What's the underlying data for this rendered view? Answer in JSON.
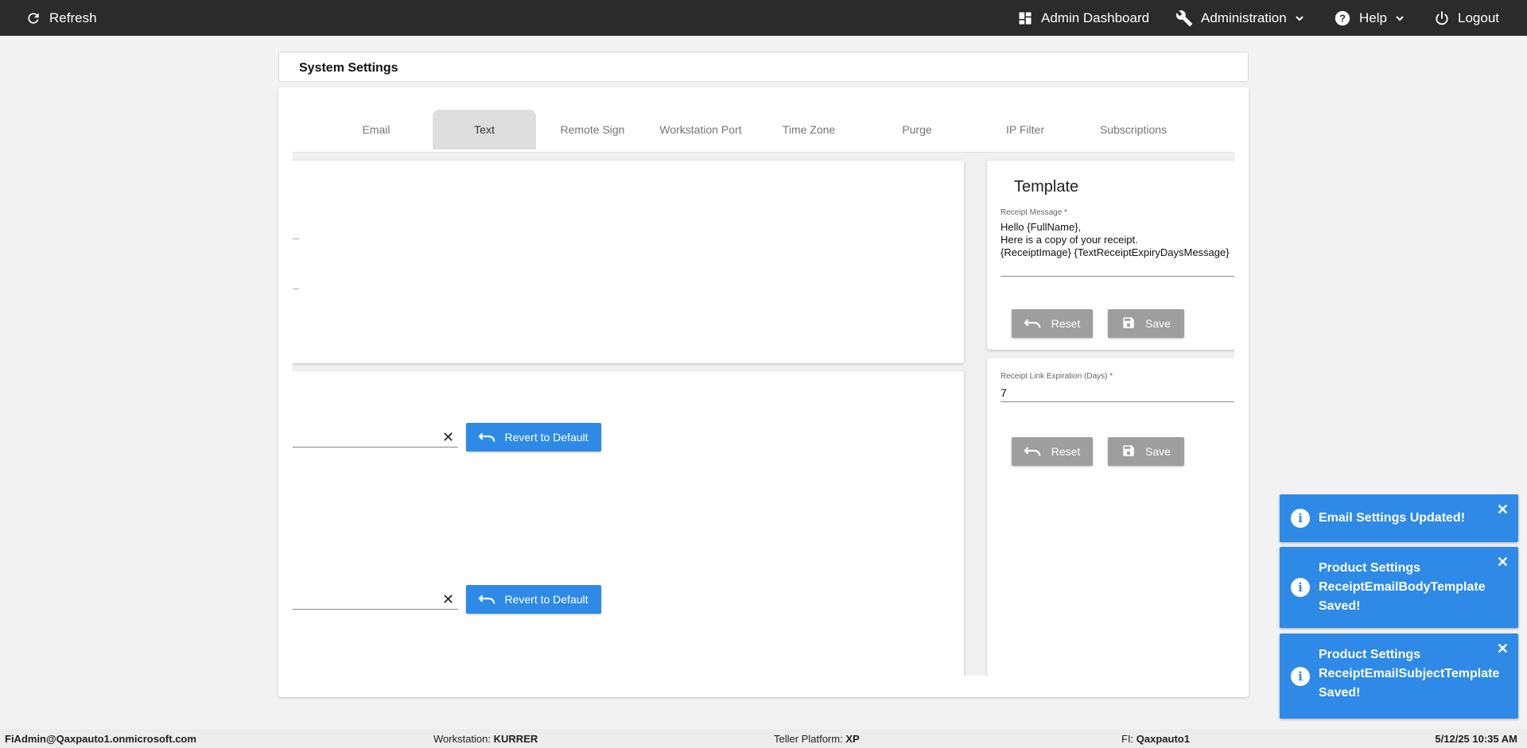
{
  "topbar": {
    "refresh": "Refresh",
    "admin_dashboard": "Admin Dashboard",
    "administration": "Administration",
    "help": "Help",
    "logout": "Logout"
  },
  "page": {
    "title": "System Settings"
  },
  "tabs": [
    {
      "label": "Email"
    },
    {
      "label": "Text"
    },
    {
      "label": "Remote Sign"
    },
    {
      "label": "Workstation Port"
    },
    {
      "label": "Time Zone"
    },
    {
      "label": "Purge"
    },
    {
      "label": "IP Filter"
    },
    {
      "label": "Subscriptions"
    }
  ],
  "left_panel": {
    "revert_label": "Revert to Default",
    "field1_value": "",
    "field2_value": ""
  },
  "template": {
    "title": "Template",
    "receipt_message_label": "Receipt Message *",
    "receipt_message_lines": [
      "Hello {FullName},",
      "Here is a copy of your receipt.",
      "{ReceiptImage} {TextReceiptExpiryDaysMessage}"
    ],
    "reset_label": "Reset",
    "save_label": "Save"
  },
  "expiration": {
    "label": "Receipt Link Expiration (Days) *",
    "value": "7",
    "reset_label": "Reset",
    "save_label": "Save"
  },
  "toasts": [
    {
      "message": "Email Settings Updated!"
    },
    {
      "message": "Product Settings ReceiptEmailBodyTemplate Saved!"
    },
    {
      "message": "Product Settings ReceiptEmailSubjectTemplate Saved!"
    }
  ],
  "footer": {
    "user": "FiAdmin@Qaxpauto1.onmicrosoft.com",
    "workstation_label": "Workstation:",
    "workstation_value": "KURRER",
    "platform_label": "Teller Platform:",
    "platform_value": "XP",
    "fi_label": "FI:",
    "fi_value": "Qaxpauto1",
    "datetime": "5/12/25 10:35 AM"
  },
  "colors": {
    "topbar": "#2b2b2b",
    "accent_blue": "#2e8ae6",
    "tab_ink": "#3f51b5",
    "button_grey": "#9e9e9e"
  }
}
